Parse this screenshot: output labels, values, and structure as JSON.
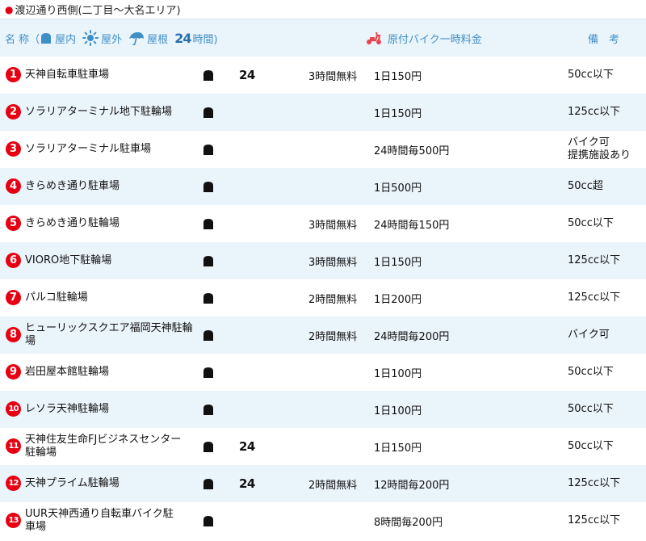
{
  "section_title": "渡辺通り西側(二丁目～大名エリア)",
  "header": {
    "name_label": "名 称（",
    "indoor_label": "屋内",
    "outdoor_label": "屋外",
    "roof_label": "屋根",
    "h24_num": "24",
    "h24_label": "時間)",
    "moto_label": "原付バイク一時料金",
    "note_label": "備　考"
  },
  "icons": {
    "indoor": "indoor-shelter-icon",
    "outdoor": "sun-icon",
    "roof": "umbrella-icon",
    "moto": "scooter-icon"
  },
  "colors": {
    "accent": "#3f8fc7",
    "number_badge": "#e60012",
    "row_alt": "#eaf4fb"
  },
  "rows": [
    {
      "num": "1",
      "name": "天神自転車駐車場",
      "h24": "24",
      "free": "3時間無料",
      "fee": "1日150円",
      "note": "50cc以下"
    },
    {
      "num": "2",
      "name": "ソラリアターミナル地下駐輪場",
      "h24": "",
      "free": "",
      "fee": "1日150円",
      "note": "125cc以下"
    },
    {
      "num": "3",
      "name": "ソラリアターミナル駐車場",
      "h24": "",
      "free": "",
      "fee": "24時間毎500円",
      "note": "バイク可\n提携施設あり"
    },
    {
      "num": "4",
      "name": "きらめき通り駐車場",
      "h24": "",
      "free": "",
      "fee": "1日500円",
      "note": "50cc超"
    },
    {
      "num": "5",
      "name": "きらめき通り駐輪場",
      "h24": "",
      "free": "3時間無料",
      "fee": "24時間毎150円",
      "note": "50cc以下"
    },
    {
      "num": "6",
      "name": "VIORO地下駐輪場",
      "h24": "",
      "free": "3時間無料",
      "fee": "1日150円",
      "note": "125cc以下"
    },
    {
      "num": "7",
      "name": "パルコ駐輪場",
      "h24": "",
      "free": "2時間無料",
      "fee": "1日200円",
      "note": "125cc以下"
    },
    {
      "num": "8",
      "name": "ヒューリックスクエア福岡天神駐輪場",
      "h24": "",
      "free": "2時間無料",
      "fee": "24時間毎200円",
      "note": "バイク可"
    },
    {
      "num": "9",
      "name": "岩田屋本館駐輪場",
      "h24": "",
      "free": "",
      "fee": "1日100円",
      "note": "50cc以下"
    },
    {
      "num": "10",
      "name": "レソラ天神駐輪場",
      "h24": "",
      "free": "",
      "fee": "1日100円",
      "note": "50cc以下"
    },
    {
      "num": "11",
      "name": "天神住友生命FJビジネスセンター\n駐輪場",
      "h24": "24",
      "free": "",
      "fee": "1日150円",
      "note": "50cc以下"
    },
    {
      "num": "12",
      "name": "天神プライム駐輪場",
      "h24": "24",
      "free": "2時間無料",
      "fee": "12時間毎200円",
      "note": "125cc以下"
    },
    {
      "num": "13",
      "name": "UUR天神西通り自転車バイク駐\n車場",
      "h24": "",
      "free": "",
      "fee": "8時間毎200円",
      "note": "125cc以下"
    }
  ]
}
